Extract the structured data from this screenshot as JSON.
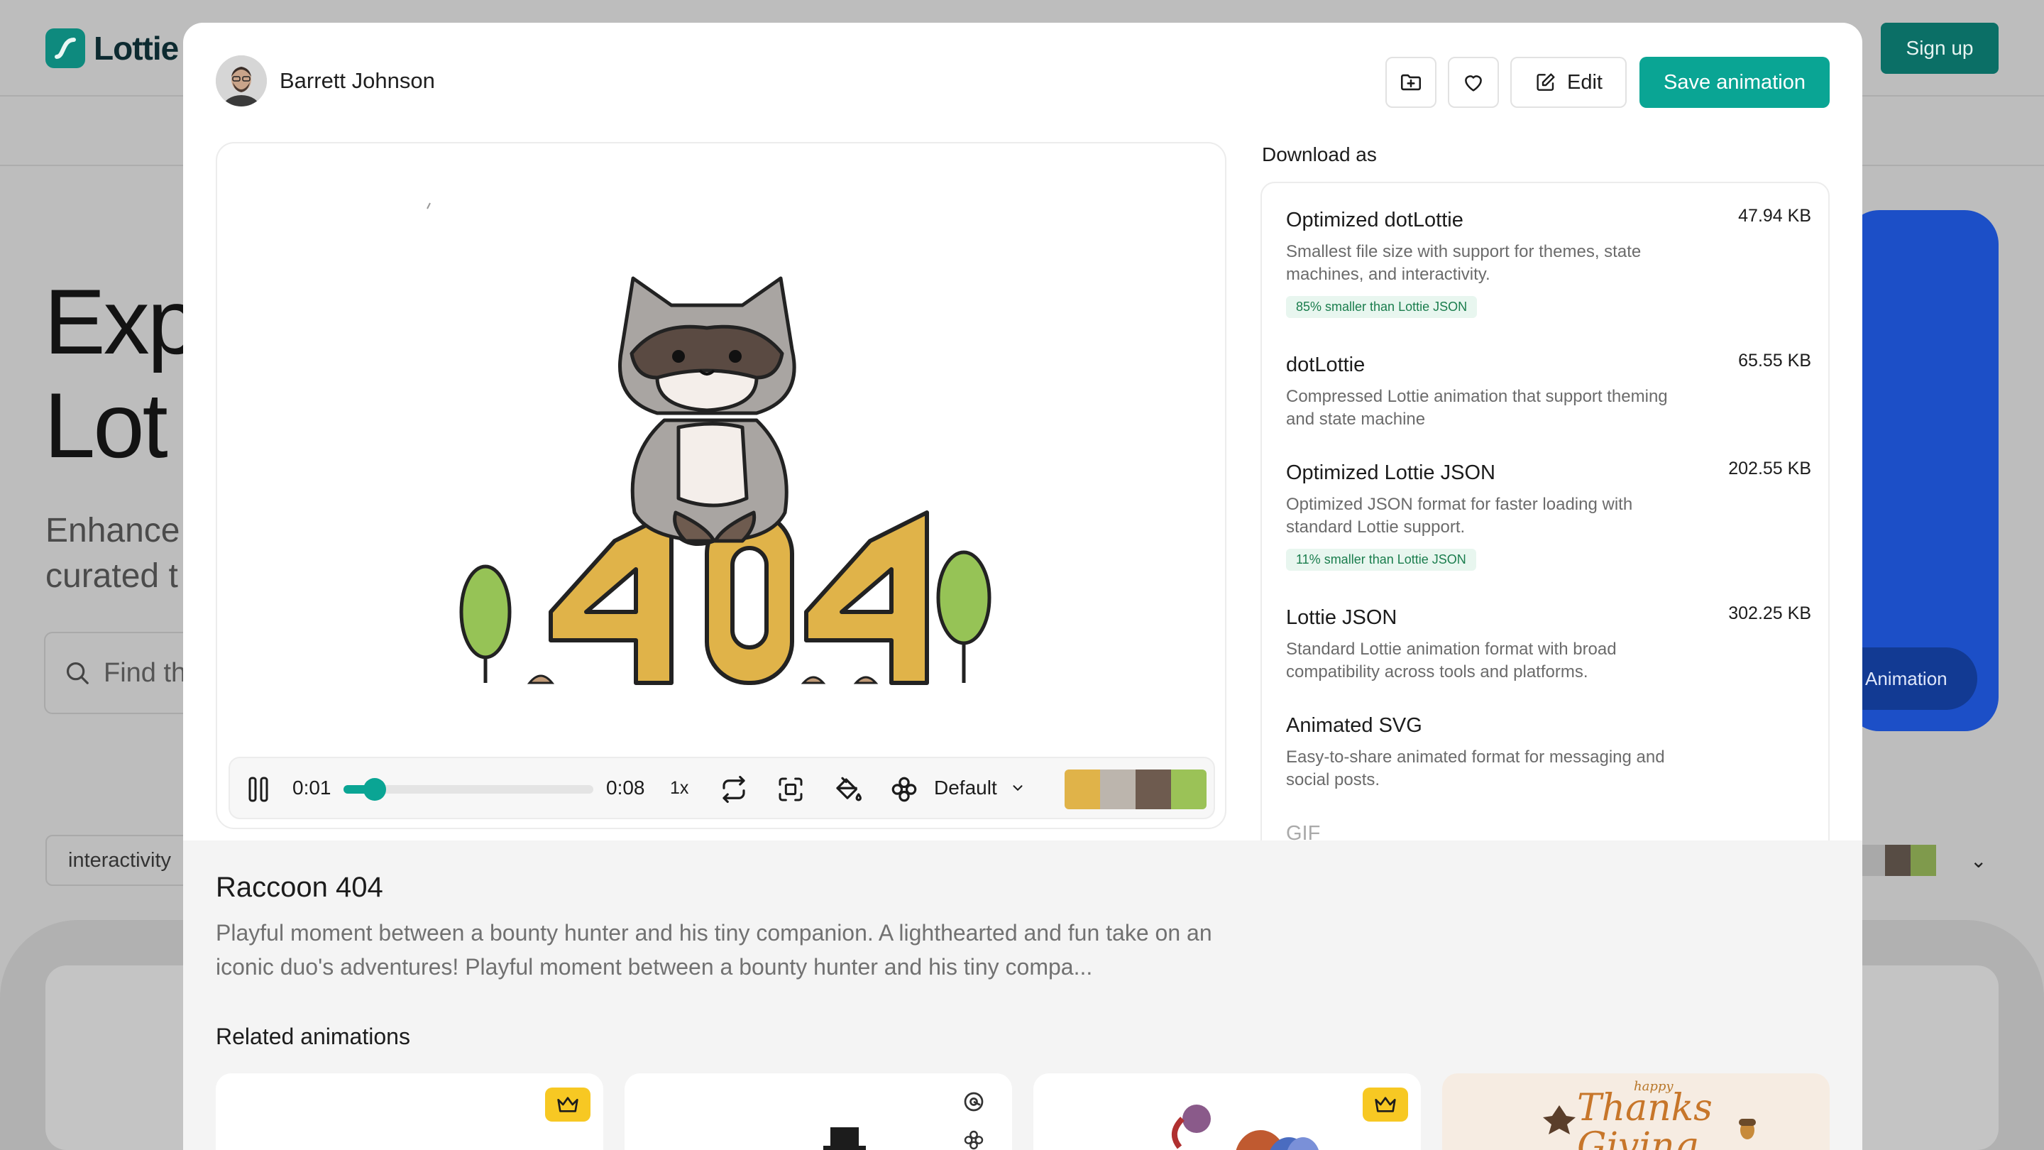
{
  "background": {
    "logo_text": "Lottie",
    "signup_label": "Sign up",
    "hero_title_line1": "Exp",
    "hero_title_line2": "Lot",
    "hero_sub_line1": "Enhance",
    "hero_sub_line2": "curated t",
    "search_placeholder": "Find th",
    "filter_chip": "interactivity",
    "promo_pill": "Animation"
  },
  "modal": {
    "author_name": "Barrett Johnson",
    "actions": {
      "add_to_collection_icon": "folder-plus-icon",
      "like_icon": "heart-icon",
      "edit_label": "Edit",
      "save_label": "Save animation"
    },
    "player": {
      "playing": true,
      "current_time": "0:01",
      "duration": "0:08",
      "progress": 0.125,
      "speed": "1x",
      "theme_label": "Default",
      "palette": [
        "#e0b349",
        "#bcb5ad",
        "#6e5b4f",
        "#9bc257"
      ]
    },
    "download": {
      "title": "Download as",
      "options": [
        {
          "name": "Optimized dotLottie",
          "size": "47.94 KB",
          "description": "Smallest file size with support for themes, state machines, and interactivity.",
          "tag": "85% smaller than Lottie JSON"
        },
        {
          "name": "dotLottie",
          "size": "65.55 KB",
          "description": "Compressed Lottie animation that support theming and state machine",
          "tag": ""
        },
        {
          "name": "Optimized Lottie JSON",
          "size": "202.55 KB",
          "description": "Optimized JSON format for faster loading with standard Lottie support.",
          "tag": "11% smaller than Lottie JSON"
        },
        {
          "name": "Lottie JSON",
          "size": "302.25 KB",
          "description": "Standard Lottie animation format with broad compatibility across tools and platforms.",
          "tag": ""
        },
        {
          "name": "Animated SVG",
          "size": "",
          "description": "Easy-to-share animated format for messaging and social posts.",
          "tag": ""
        },
        {
          "name": "GIF",
          "size": "",
          "description": "",
          "tag": ""
        }
      ]
    },
    "animation": {
      "title": "Raccoon 404",
      "description": "Playful moment between a bounty hunter and his tiny companion. A lighthearted and fun take on an iconic duo's adventures! Playful moment between a bounty hunter and his tiny compa..."
    },
    "related": {
      "title": "Related animations",
      "thanks_small": "happy",
      "thanks_big1": "Thanks",
      "thanks_big2": "Giving"
    }
  },
  "colors": {
    "accent": "#0aa594",
    "tag_bg": "#e8f6ef",
    "tag_text": "#1a7d4d",
    "premium": "#f7c823"
  }
}
